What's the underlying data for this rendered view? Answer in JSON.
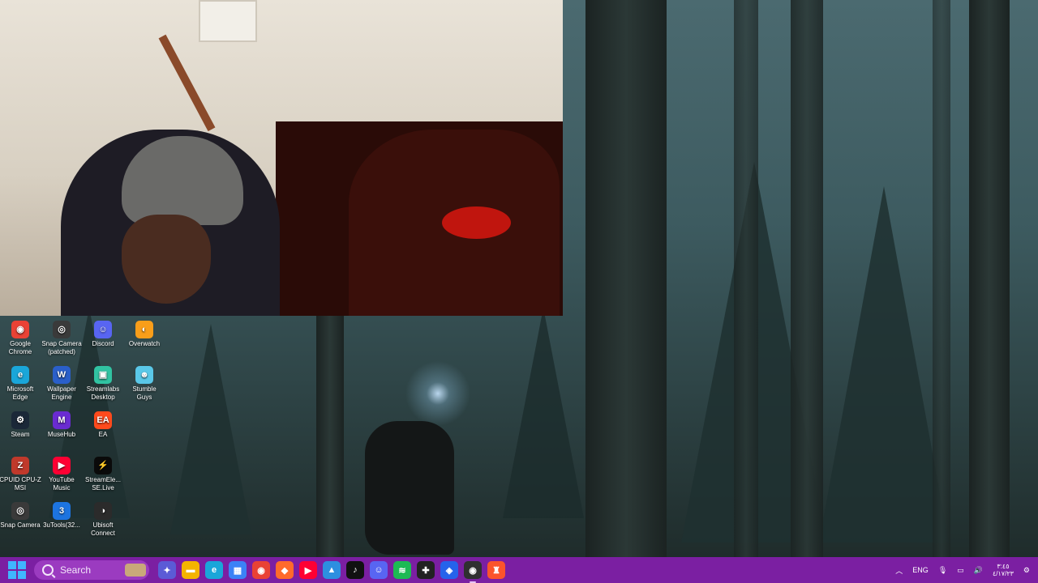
{
  "desktop": {
    "icons": [
      {
        "label_l1": "Google",
        "label_l2": "Chrome",
        "color": "#e94235",
        "glyph": "◉",
        "icon": "chrome-icon"
      },
      {
        "label_l1": "Snap Camera",
        "label_l2": "(patched)",
        "color": "#3a3a3a",
        "glyph": "◎",
        "icon": "snap-camera-icon"
      },
      {
        "label_l1": "Discord",
        "label_l2": "",
        "color": "#5865f2",
        "glyph": "☺",
        "icon": "discord-icon"
      },
      {
        "label_l1": "Overwatch",
        "label_l2": "",
        "color": "#f99e1a",
        "glyph": "◐",
        "icon": "overwatch-icon"
      },
      {
        "label_l1": "Microsoft",
        "label_l2": "Edge",
        "color": "#1aa6d9",
        "glyph": "e",
        "icon": "edge-icon"
      },
      {
        "label_l1": "Wallpaper",
        "label_l2": "Engine",
        "color": "#2a5fc9",
        "glyph": "W",
        "icon": "wallpaper-engine-icon"
      },
      {
        "label_l1": "Streamlabs",
        "label_l2": "Desktop",
        "color": "#31c3a2",
        "glyph": "▣",
        "icon": "streamlabs-icon"
      },
      {
        "label_l1": "Stumble",
        "label_l2": "Guys",
        "color": "#5ac8e8",
        "glyph": "☻",
        "icon": "stumble-guys-icon"
      },
      {
        "label_l1": "Steam",
        "label_l2": "",
        "color": "#1b2838",
        "glyph": "⚙",
        "icon": "steam-icon"
      },
      {
        "label_l1": "MuseHub",
        "label_l2": "",
        "color": "#6a2bd1",
        "glyph": "M",
        "icon": "musehub-icon"
      },
      {
        "label_l1": "EA",
        "label_l2": "",
        "color": "#ff4a1c",
        "glyph": "EA",
        "icon": "ea-icon"
      },
      {
        "label_l1": "",
        "label_l2": "",
        "color": "",
        "glyph": "",
        "icon": ""
      },
      {
        "label_l1": "CPUID CPU-Z",
        "label_l2": "MSI",
        "color": "#c0392b",
        "glyph": "Z",
        "icon": "cpu-z-icon"
      },
      {
        "label_l1": "YouTube",
        "label_l2": "Music",
        "color": "#ff0033",
        "glyph": "▶",
        "icon": "youtube-music-icon"
      },
      {
        "label_l1": "StreamEle...",
        "label_l2": "SE.Live",
        "color": "#0a0a0a",
        "glyph": "⚡",
        "icon": "streamelements-icon"
      },
      {
        "label_l1": "",
        "label_l2": "",
        "color": "",
        "glyph": "",
        "icon": ""
      },
      {
        "label_l1": "Snap Camera",
        "label_l2": "",
        "color": "#3a3a3a",
        "glyph": "◎",
        "icon": "snap-camera-2-icon"
      },
      {
        "label_l1": "3uTools(32...",
        "label_l2": "",
        "color": "#1d74e0",
        "glyph": "3",
        "icon": "3utools-icon"
      },
      {
        "label_l1": "Ubisoft",
        "label_l2": "Connect",
        "color": "#2b2b2b",
        "glyph": "◑",
        "icon": "ubisoft-connect-icon"
      }
    ]
  },
  "taskbar": {
    "search_label": "Search",
    "apps": [
      {
        "name": "copilot-icon",
        "color": "#5b5bd6",
        "glyph": "✦",
        "active": false
      },
      {
        "name": "file-explorer-icon",
        "color": "#f4b400",
        "glyph": "▬",
        "active": false
      },
      {
        "name": "edge-icon",
        "color": "#1aa6d9",
        "glyph": "e",
        "active": false
      },
      {
        "name": "store-icon",
        "color": "#3b82f6",
        "glyph": "▦",
        "active": false
      },
      {
        "name": "chrome-icon",
        "color": "#e94235",
        "glyph": "◉",
        "active": false
      },
      {
        "name": "app-orange-icon",
        "color": "#ff6a2b",
        "glyph": "◆",
        "active": false
      },
      {
        "name": "youtube-music-icon",
        "color": "#ff0033",
        "glyph": "▶",
        "active": false
      },
      {
        "name": "photos-icon",
        "color": "#2d8fe0",
        "glyph": "▲",
        "active": false
      },
      {
        "name": "tiktok-icon",
        "color": "#111111",
        "glyph": "♪",
        "active": false
      },
      {
        "name": "discord-icon",
        "color": "#5865f2",
        "glyph": "☺",
        "active": false
      },
      {
        "name": "spotify-icon",
        "color": "#1db954",
        "glyph": "≋",
        "active": false
      },
      {
        "name": "game-controller-icon",
        "color": "#222222",
        "glyph": "✚",
        "active": false
      },
      {
        "name": "app-blue-icon",
        "color": "#2563eb",
        "glyph": "◈",
        "active": false
      },
      {
        "name": "obs-icon",
        "color": "#303030",
        "glyph": "◉",
        "active": true
      },
      {
        "name": "brave-icon",
        "color": "#fb542b",
        "glyph": "♜",
        "active": false
      }
    ],
    "tray": {
      "language": "ENG",
      "time": "٣:٤٥",
      "date": "٤/١٧/٢٣"
    }
  }
}
